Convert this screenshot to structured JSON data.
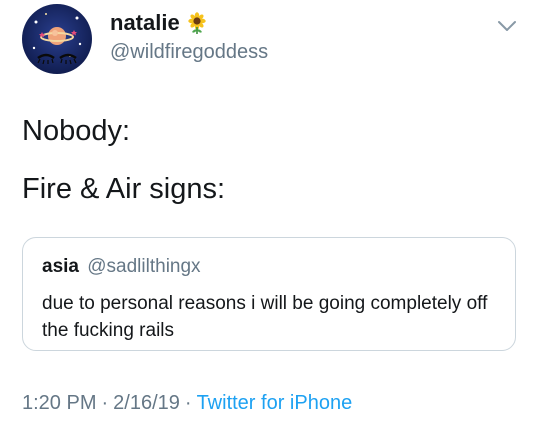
{
  "author": {
    "display_name": "natalie",
    "handle": "@wildfiregoddess",
    "name_emoji": "sunflower-icon"
  },
  "tweet": {
    "line1": "Nobody:",
    "line2": "Fire & Air signs:"
  },
  "quoted": {
    "display_name": "asia",
    "handle": "@sadlilthingx",
    "text": "due to personal reasons i will be going completely off the fucking rails"
  },
  "meta": {
    "time": "1:20 PM",
    "date": "2/16/19",
    "separator": "·",
    "source": "Twitter for iPhone"
  },
  "colors": {
    "text": "#14171a",
    "secondary": "#657786",
    "link": "#1da1f2",
    "border": "#ccd6dd"
  }
}
